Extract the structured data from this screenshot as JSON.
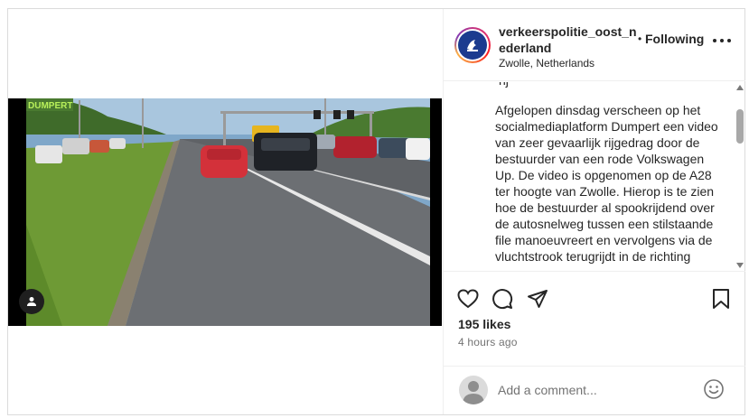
{
  "post": {
    "username": "verkeerspolitie_oost_nederland",
    "location": "Zwolle, Netherlands",
    "follow_separator": "•",
    "follow_state": "Following",
    "caption_partial_top": "nj",
    "caption": "Afgelopen dinsdag verscheen op het socialmediaplatform Dumpert een video van zeer gevaarlijk rijgedrag door de bestuurder van een rode Volkswagen Up. De video is opgenomen op de A28 ter hoogte van Zwolle. Hierop is te zien hoe de bestuurder al spookrijdend over de autosnelweg tussen een stilstaande file manoeuvreert en vervolgens via de vluchtstrook terugrijdt in de richting",
    "likes": "195 likes",
    "time": "4 hours ago"
  },
  "video": {
    "watermark": "DUMPERT"
  },
  "comment_box": {
    "placeholder": "Add a comment..."
  },
  "icons": [
    "user-tag-icon",
    "police-logo-icon",
    "more-options-icon",
    "heart-icon",
    "comment-icon",
    "share-icon",
    "bookmark-icon",
    "emoji-icon"
  ],
  "colors": {
    "text": "#262626",
    "secondary": "#737373",
    "border": "#dbdbdb",
    "police_blue": "#1b3b8f"
  }
}
